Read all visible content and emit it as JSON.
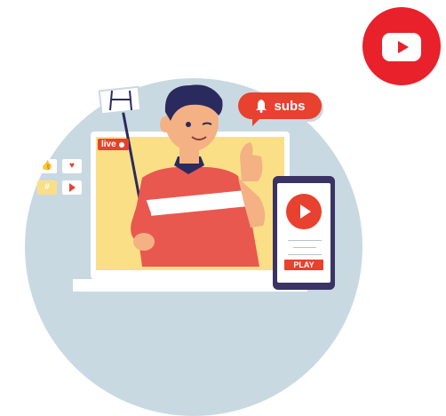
{
  "illustration": {
    "live_label": "live",
    "subs_label": "subs",
    "phone_button_label": "PLAY",
    "icons": [
      "youtube-logo-icon",
      "bell-icon",
      "thumbs-up-icon",
      "heart-icon",
      "hashtag-icon",
      "play-icon",
      "live-dot-icon",
      "phone-play-icon"
    ]
  },
  "colors": {
    "brand_red": "#e8212b",
    "accent_red": "#e8412f",
    "backdrop": "#c9d9e2",
    "screen_yellow": "#fbdf87",
    "phone_body": "#3a3363",
    "hair": "#2b2a5e"
  }
}
